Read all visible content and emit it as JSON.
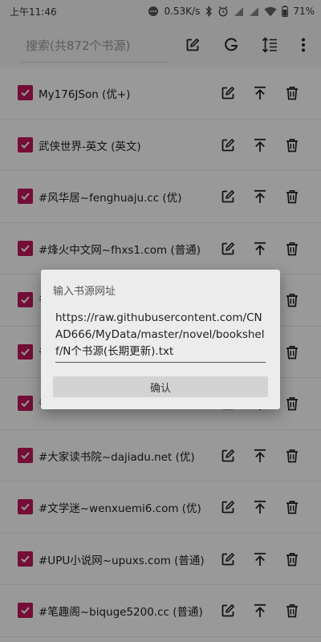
{
  "status_bar": {
    "time": "上午11:46",
    "network_speed": "0.53K/s",
    "battery": "71%"
  },
  "toolbar": {
    "search_placeholder": "搜索(共872个书源)",
    "icons": [
      "edit-icon",
      "google-icon",
      "sort-icon",
      "more-vert-icon"
    ]
  },
  "sources": [
    {
      "label": "My176JSon (优+)",
      "checked": true
    },
    {
      "label": "武侠世界-英文 (英文)",
      "checked": true
    },
    {
      "label": "#风华居~fenghuaju.cc (优)",
      "checked": true
    },
    {
      "label": "#烽火中文网~fhxs1.com (普通)",
      "checked": true
    },
    {
      "label": "#",
      "checked": true
    },
    {
      "label": "#",
      "checked": true
    },
    {
      "label": "#",
      "checked": true
    },
    {
      "label": "#大家读书院~dajiadu.net (优)",
      "checked": true
    },
    {
      "label": "#文学迷~wenxuemi6.com (优)",
      "checked": true
    },
    {
      "label": "#UPU小说网~upuxs.com (普通)",
      "checked": true
    },
    {
      "label": "#笔趣阁~biquge5200.cc (普通)",
      "checked": true
    }
  ],
  "row_actions": [
    "edit-icon",
    "move-to-top-icon",
    "delete-icon"
  ],
  "dialog": {
    "title": "输入书源网址",
    "url": "https://raw.githubusercontent.com/CNAD666/MyData/master/novel/bookshelf/N个书源(长期更新).txt",
    "confirm_label": "确认"
  },
  "colors": {
    "accent": "#c2185b",
    "toolbar_bg": "#f5f5f5",
    "dialog_bg": "#ececec",
    "scrim": "rgba(0,0,0,0.40)"
  }
}
